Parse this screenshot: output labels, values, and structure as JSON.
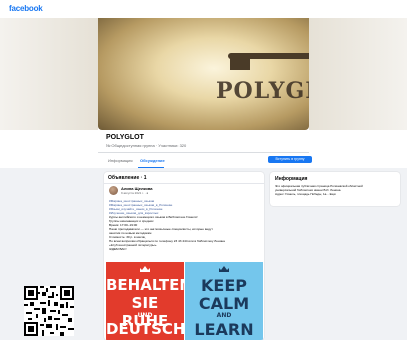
{
  "topbar": {
    "logo": "facebook"
  },
  "cover": {
    "word": "POLYGLOT"
  },
  "group": {
    "title": "POLYGLOT",
    "meta": "№ Общедоступная группа · Участники: 320"
  },
  "tabs": [
    {
      "label": "Информация"
    },
    {
      "label": "Обсуждение"
    }
  ],
  "join_label": "Вступить в группу",
  "post": {
    "section_title": "Объявление · 1",
    "author": "Алина Щелкова",
    "date": "9 августа 2021 г. · ●",
    "lines": [
      "#Марина_иностранных_языков",
      "#Марина_иностранных_языков_в_Рогачеве",
      "#Языки_изучайте_языки_в_Рогачеве",
      "#Изучение_языков_для_взрослых",
      "Курсы английского и немецкого языков в Библиотеке Гомеля!",
      "Группы начинающих и средних",
      "Время: 17:00–19:00",
      "Наши преподаватели — это англоязычные специалисты, которые ведут",
      "занятия по новым методикам",
      "Стоимость: 30 р. в месяц",
      "По всем вопросам обращаться по телефону 23 43 444 или в библиотеку Ленина",
      "«Клуб иностранной литературы»",
      "ЖДЕМ ВАС!"
    ],
    "images": {
      "de": {
        "line1": "BEHALTEN",
        "line2": "SIE RUHE",
        "line3": "UND",
        "line4": "DEUTSCH"
      },
      "en": {
        "line1": "KEEP",
        "line2": "CALM",
        "line3": "AND",
        "line4": "LEARN"
      }
    }
  },
  "info": {
    "title": "Информация",
    "lines": [
      "Это официальная публичная страница Рогачевской областной",
      "универсальной библиотеки имени В.И. Ленина.",
      "Адрес: Гомель, площадь Победы, 1а... Ещё"
    ]
  },
  "colors": {
    "brand": "#1877f2",
    "feed_bg": "#f0f2f5",
    "poster_red": "#e23b2c",
    "poster_blue": "#74c6ec"
  }
}
